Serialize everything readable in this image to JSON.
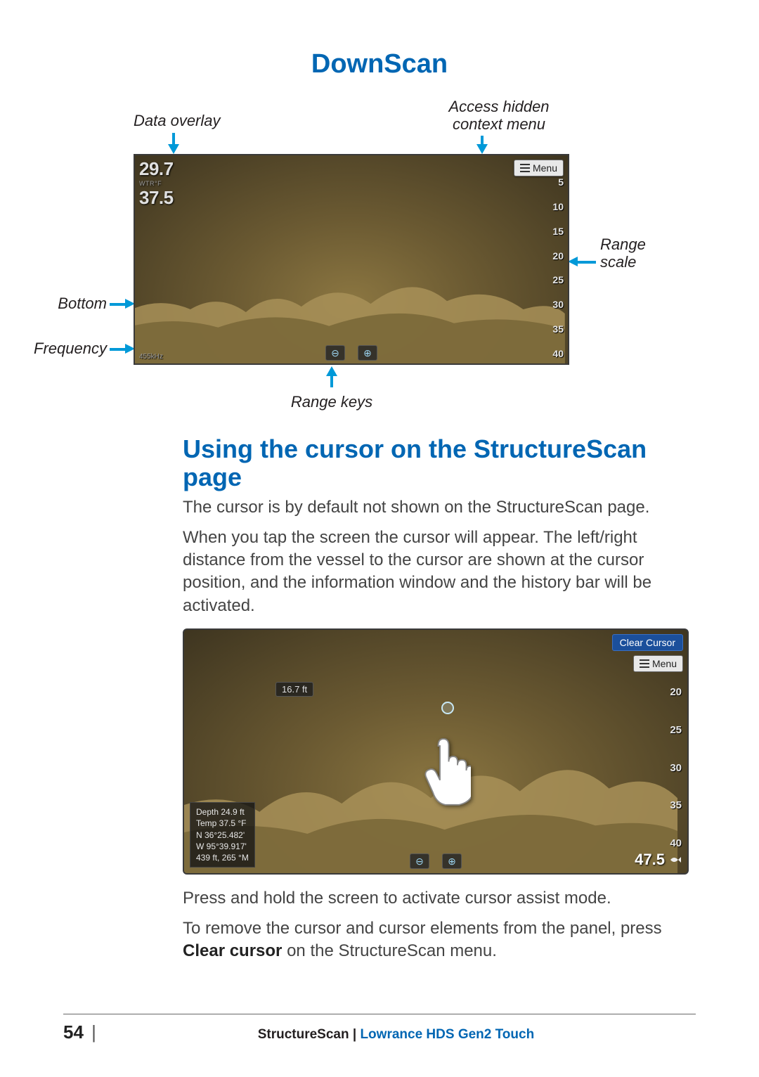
{
  "title_downscan": "DownScan",
  "callouts": {
    "data_overlay": "Data overlay",
    "context_menu_l1": "Access hidden",
    "context_menu_l2": "context menu",
    "range_scale_l1": "Range",
    "range_scale_l2": "scale",
    "bottom": "Bottom",
    "frequency": "Frequency",
    "range_keys": "Range keys"
  },
  "sonar1": {
    "overlay_depth": "29.7",
    "overlay_label": "WTR°F",
    "overlay_temp": "37.5",
    "menu_label": "Menu",
    "ticks": [
      "5",
      "10",
      "15",
      "20",
      "25",
      "30",
      "35",
      "40"
    ],
    "freq": "455kHz"
  },
  "section_heading": "Using the cursor on the StructureScan page",
  "para1": "The cursor is by default not shown on the StructureScan page.",
  "para2": "When you tap the screen the cursor will appear. The left/right distance from the vessel to the cursor are shown at the cursor position, and the  information window and the history bar will be activated.",
  "sonar2": {
    "clear_cursor": "Clear Cursor",
    "menu_label": "Menu",
    "cursor_distance": "16.7 ft",
    "info_depth": "Depth  24.9  ft",
    "info_temp": "Temp  37.5 °F",
    "info_n": "N   36°25.482'",
    "info_w": "W  95°39.917'",
    "info_foot": "439 ft, 265 °M",
    "ticks": [
      "20",
      "25",
      "30",
      "35",
      "40"
    ],
    "br_depth": "47.5"
  },
  "para3": "Press and hold the screen to activate cursor assist mode.",
  "para4a": "To remove the cursor and cursor elements from the panel, press ",
  "para4b": "Clear cursor",
  "para4c": " on the StructureScan menu.",
  "footer": {
    "page": "54",
    "section": "StructureScan",
    "sep": " | ",
    "brand": "Lowrance HDS Gen2 Touch"
  }
}
